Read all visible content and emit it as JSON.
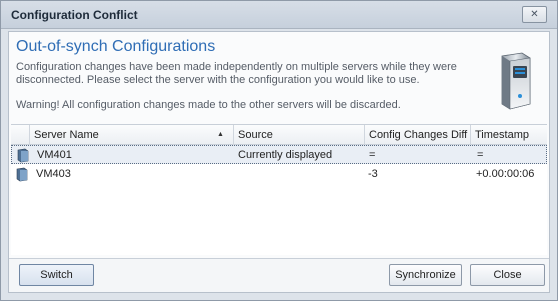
{
  "window": {
    "title": "Configuration Conflict",
    "close_glyph": "✕"
  },
  "header": {
    "heading": "Out-of-synch Configurations",
    "description": "Configuration changes have been made independently on multiple servers while they were disconnected. Please select the server with the configuration you would like to use.",
    "warning": "Warning! All configuration changes made to the other servers will be discarded.",
    "icon": "server-tower-icon"
  },
  "grid": {
    "columns": {
      "server_name": "Server Name",
      "source": "Source",
      "config_diff": "Config Changes Diff",
      "timestamp_diff": "Timestamp Diff"
    },
    "sort_indicator": "▲",
    "rows": [
      {
        "server": "VM401",
        "source": "Currently displayed",
        "config_diff": "=",
        "timestamp_diff": "="
      },
      {
        "server": "VM403",
        "source": "",
        "config_diff": "-3",
        "timestamp_diff": "+0.00:00:06"
      }
    ]
  },
  "footer": {
    "switch_label": "Switch",
    "synchronize_label": "Synchronize",
    "close_label": "Close"
  }
}
